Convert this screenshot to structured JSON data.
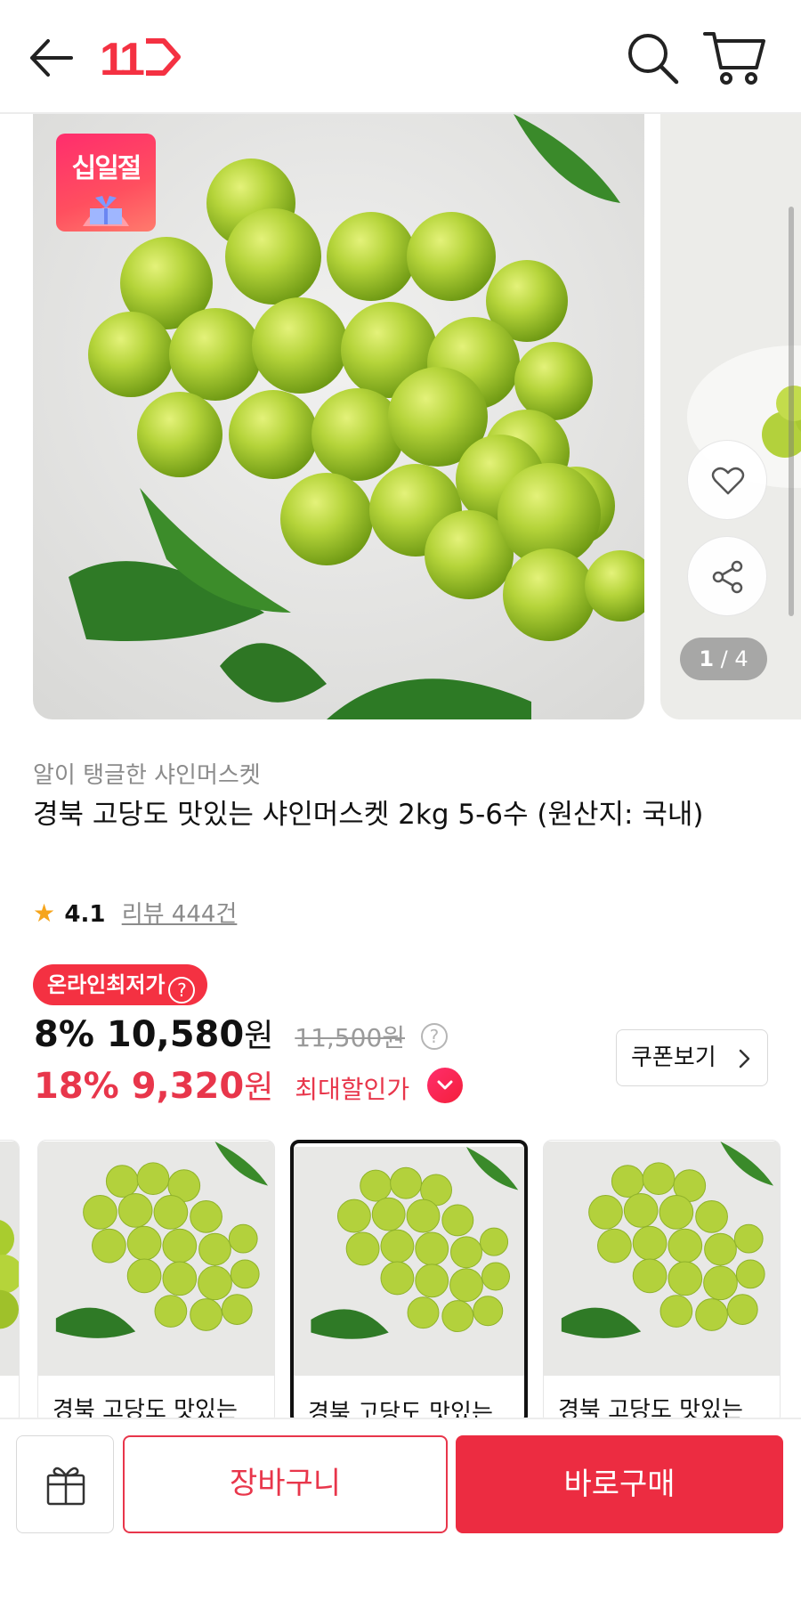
{
  "header": {
    "logo_text": "11",
    "icons": [
      "back-arrow-icon",
      "11st-logo",
      "search-icon",
      "cart-icon"
    ]
  },
  "gallery": {
    "badge_text": "십일절",
    "counter_current": "1",
    "counter_total": "/ 4"
  },
  "product": {
    "subtitle": "알이 탱글한 샤인머스켓",
    "title": "경북 고당도 맛있는 샤인머스켓 2kg 5-6수 (원산지: 국내)",
    "rating": "4.1",
    "reviews": "리뷰 444건"
  },
  "price": {
    "lowest_badge": "온라인최저가",
    "discount_pct": "8%",
    "sale_price": "10,580",
    "won": "원",
    "original_price": "11,500원",
    "max_discount_pct": "18%",
    "max_price": "9,320",
    "max_label": "최대할인가",
    "coupon_label": "쿠폰보기"
  },
  "related": {
    "items": [
      {
        "name": "경북 고당도 맛있는"
      },
      {
        "name": "경북 고당도 맛있는"
      },
      {
        "name": "경북 고당도 맛있는"
      }
    ]
  },
  "bottom_bar": {
    "cart_label": "장바구니",
    "buy_label": "바로구매"
  },
  "colors": {
    "accent": "#ec2c41",
    "badge": "#f43142",
    "star": "#f6a51c"
  }
}
